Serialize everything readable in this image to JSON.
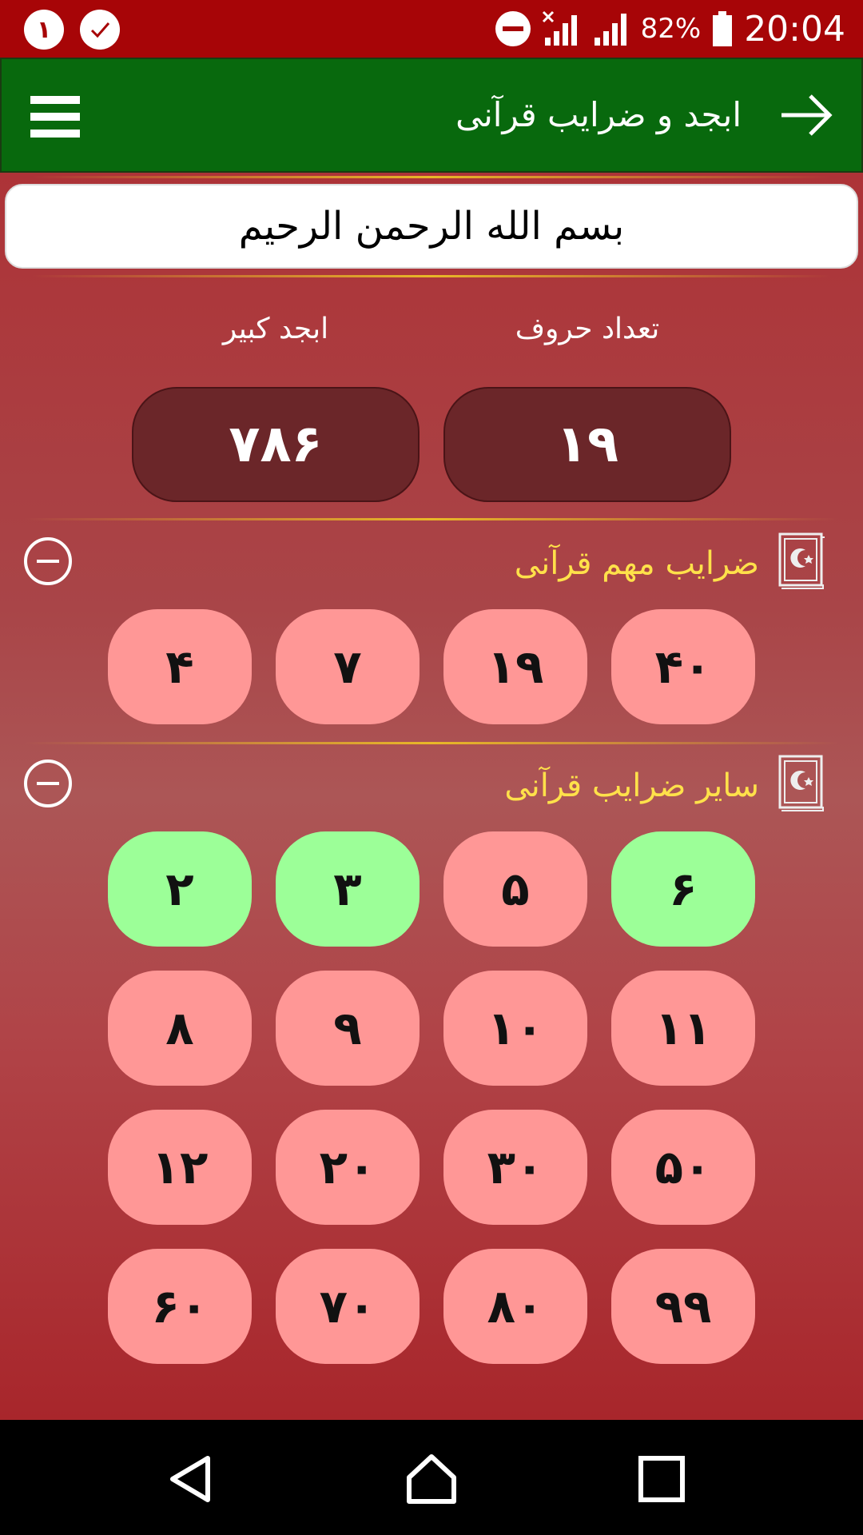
{
  "status_bar": {
    "notif_1": "١",
    "notif_2_icon": "check-icon",
    "battery_percent": "82%",
    "time": "20:04"
  },
  "app_bar": {
    "title": "ابجد و ضرایب قرآنی",
    "back_icon": "arrow-right-icon",
    "menu_icon": "hamburger-menu-icon"
  },
  "input": {
    "value": "بسم الله الرحمن الرحیم"
  },
  "stats": {
    "letter_count_label": "تعداد حروف",
    "letter_count_value": "١٩",
    "abjad_label": "ابجد کبیر",
    "abjad_value": "٧٨۶"
  },
  "sections": [
    {
      "title": "ضرایب مهم قرآنی",
      "numbers": [
        {
          "label": "۴٠",
          "state": "pink"
        },
        {
          "label": "١٩",
          "state": "pink"
        },
        {
          "label": "٧",
          "state": "pink"
        },
        {
          "label": "۴",
          "state": "pink"
        }
      ]
    },
    {
      "title": "سایر ضرایب قرآنی",
      "numbers": [
        {
          "label": "۶",
          "state": "green"
        },
        {
          "label": "۵",
          "state": "pink"
        },
        {
          "label": "٣",
          "state": "green"
        },
        {
          "label": "٢",
          "state": "green"
        },
        {
          "label": "١١",
          "state": "pink"
        },
        {
          "label": "١٠",
          "state": "pink"
        },
        {
          "label": "٩",
          "state": "pink"
        },
        {
          "label": "٨",
          "state": "pink"
        },
        {
          "label": "۵٠",
          "state": "pink"
        },
        {
          "label": "٣٠",
          "state": "pink"
        },
        {
          "label": "٢٠",
          "state": "pink"
        },
        {
          "label": "١٢",
          "state": "pink"
        },
        {
          "label": "٩٩",
          "state": "pink"
        },
        {
          "label": "٨٠",
          "state": "pink"
        },
        {
          "label": "٧٠",
          "state": "pink"
        },
        {
          "label": "۶٠",
          "state": "pink"
        }
      ]
    }
  ],
  "colors": {
    "status_bar": "#a70507",
    "app_bar": "#08690d",
    "match_green": "#9cff98",
    "no_match_pink": "#ff9796",
    "section_title": "#ffe14a"
  }
}
